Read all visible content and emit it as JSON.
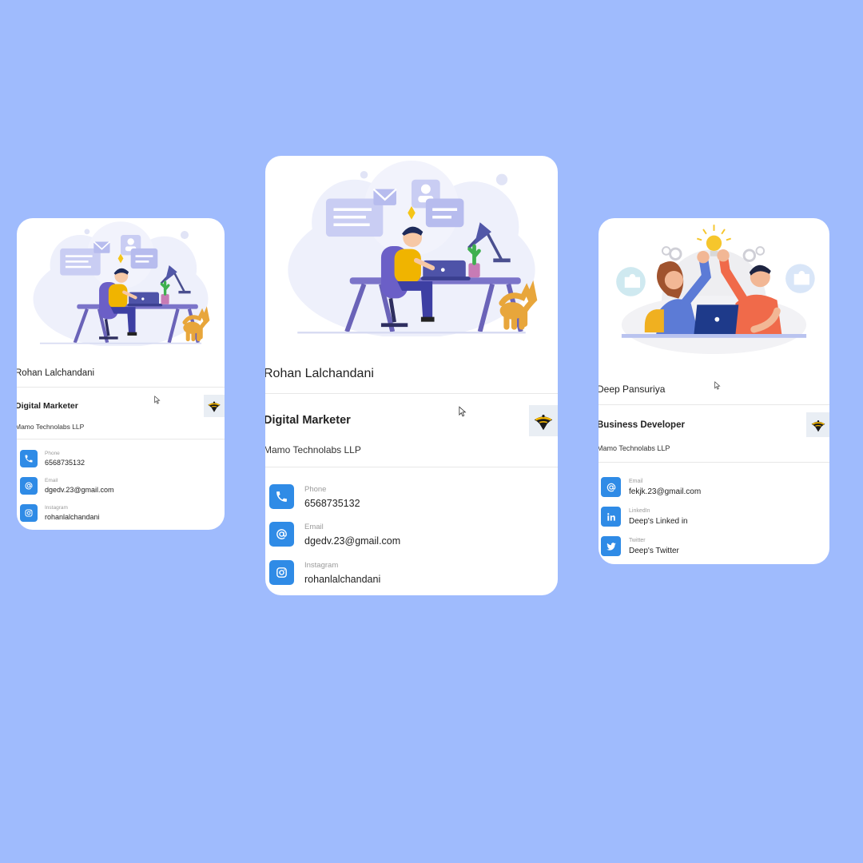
{
  "cards": [
    {
      "name": "Rohan Lalchandani",
      "role": "Digital Marketer",
      "company": "Mamo Technolabs LLP",
      "logo_text": "GOLDEN VIEW",
      "contacts": [
        {
          "icon": "phone-icon",
          "label": "Phone",
          "value": "6568735132"
        },
        {
          "icon": "at-icon",
          "label": "Email",
          "value": "dgedv.23@gmail.com"
        },
        {
          "icon": "instagram-icon",
          "label": "Instagram",
          "value": "rohanlalchandani"
        }
      ]
    },
    {
      "name": "Rohan Lalchandani",
      "role": "Digital Marketer",
      "company": "Mamo Technolabs LLP",
      "logo_text": "GOLDEN VIEW",
      "contacts": [
        {
          "icon": "phone-icon",
          "label": "Phone",
          "value": "6568735132"
        },
        {
          "icon": "at-icon",
          "label": "Email",
          "value": "dgedv.23@gmail.com"
        },
        {
          "icon": "instagram-icon",
          "label": "Instagram",
          "value": "rohanlalchandani"
        }
      ]
    },
    {
      "name": "Deep Pansuriya",
      "role": "Business Developer",
      "company": "Mamo Technolabs LLP",
      "logo_text": "GOLDEN VIEW",
      "contacts": [
        {
          "icon": "at-icon",
          "label": "Email",
          "value": "fekjk.23@gmail.com"
        },
        {
          "icon": "linkedin-icon",
          "label": "LinkedIn",
          "value": "Deep's Linked in"
        },
        {
          "icon": "twitter-icon",
          "label": "Twitter",
          "value": "Deep's Twitter"
        }
      ]
    }
  ],
  "colors": {
    "background": "#9fbbfd",
    "accent": "#2f8be6",
    "card": "#ffffff"
  }
}
